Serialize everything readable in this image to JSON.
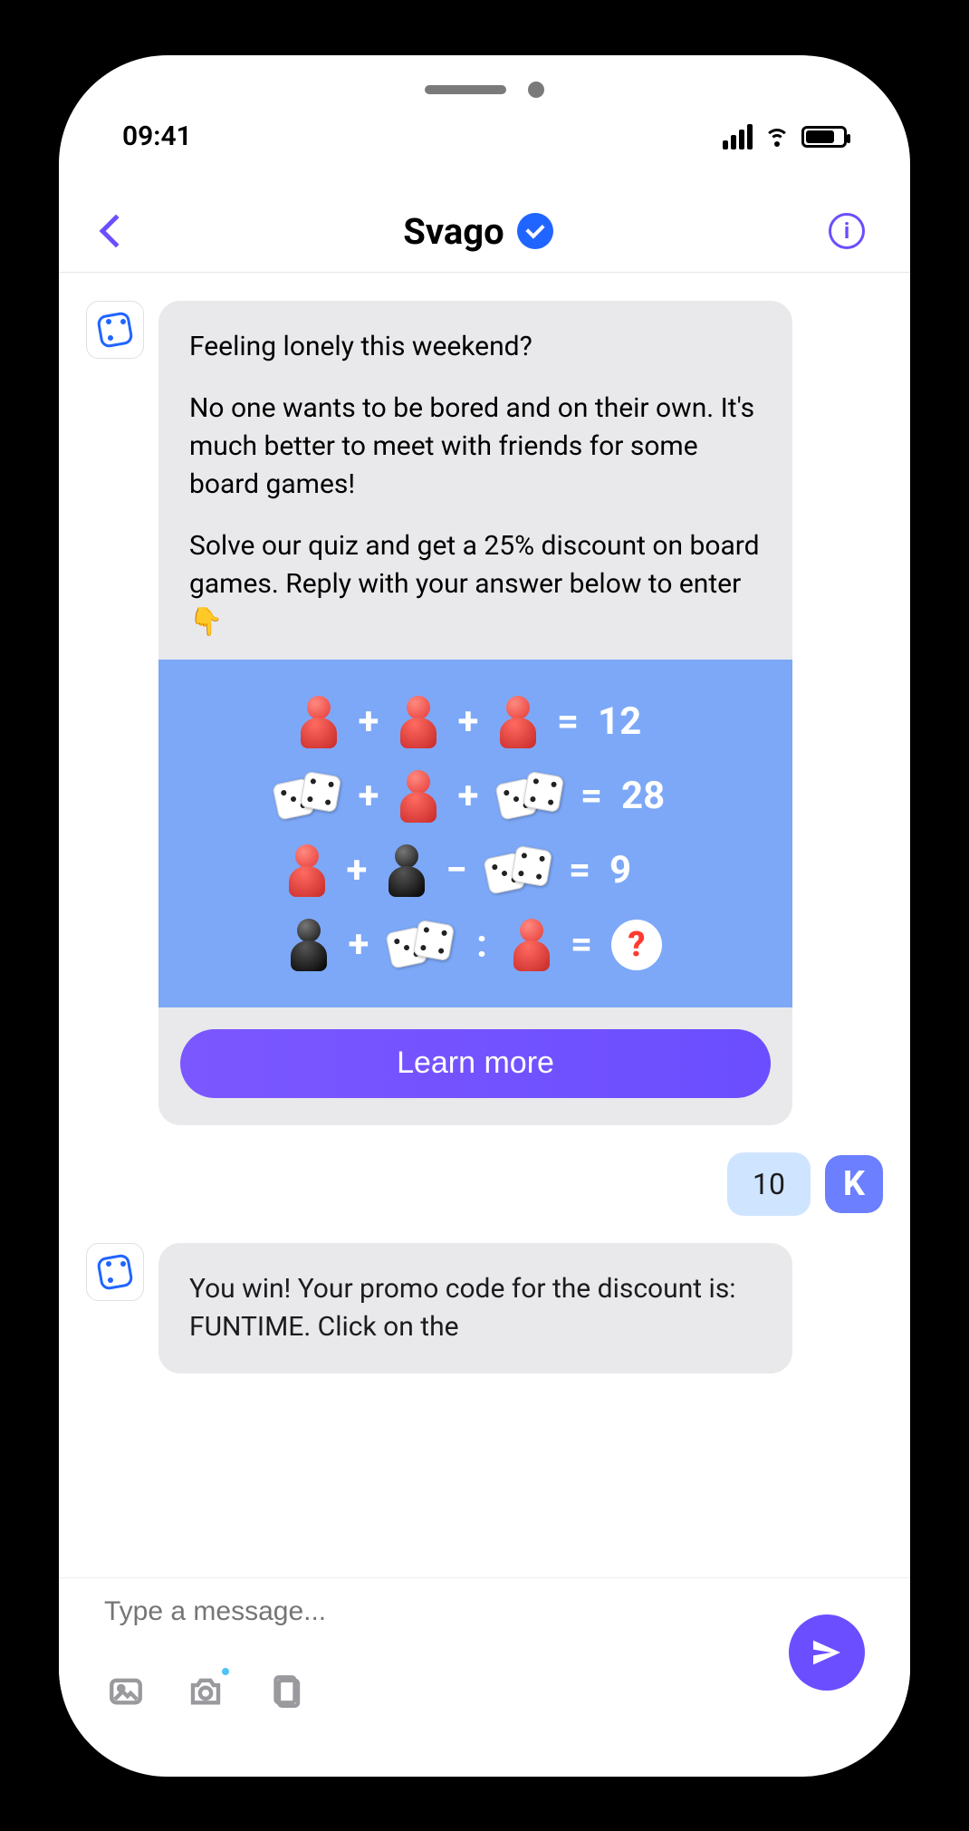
{
  "status": {
    "time": "09:41"
  },
  "nav": {
    "title": "Svago"
  },
  "messages": {
    "msg1": {
      "p1": "Feeling lonely this weekend?",
      "p2": "No one wants to be bored and on their own. It's much better to meet with friends for some board games!",
      "p3": "Solve our quiz and get a 25% discount on board games. Reply with your answer below to enter 👇"
    },
    "cta_label": "Learn more",
    "user_reply": "10",
    "msg2": {
      "p1": "You win! Your promo code for the discount is: FUNTIME. Click on the"
    }
  },
  "quiz": {
    "row1": {
      "a": "pawn-red",
      "op1": "+",
      "b": "pawn-red",
      "op2": "+",
      "c": "pawn-red",
      "result": "12"
    },
    "row2": {
      "a": "dice",
      "op1": "+",
      "b": "pawn-red",
      "op2": "+",
      "c": "dice",
      "result": "28"
    },
    "row3": {
      "a": "pawn-red",
      "op1": "+",
      "b": "pawn-black",
      "op2": "−",
      "c": "dice",
      "result": "9"
    },
    "row4": {
      "a": "pawn-black",
      "op1": "+",
      "b": "dice",
      "op2": ":",
      "c": "pawn-red",
      "result": "?"
    }
  },
  "input": {
    "placeholder": "Type a message..."
  },
  "user": {
    "initial": "K"
  }
}
